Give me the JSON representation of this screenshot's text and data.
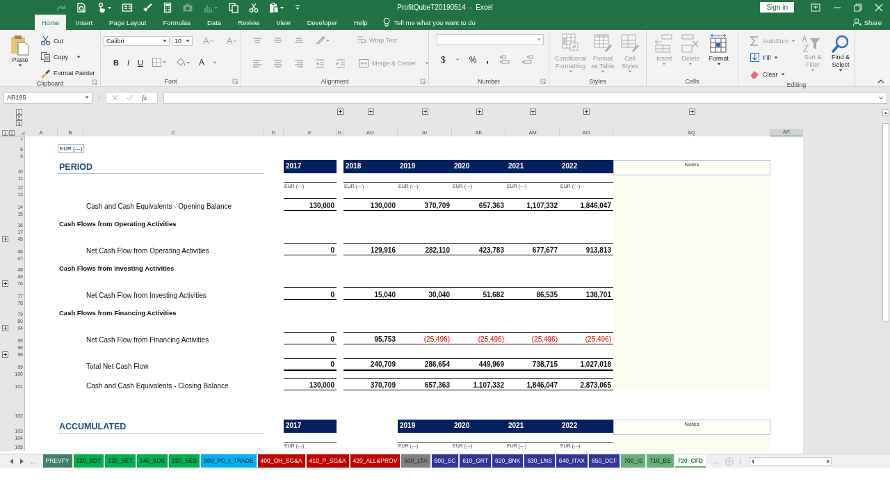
{
  "title_bar": {
    "title": "ProfitQubeT20190514  -  Excel",
    "sign_in": "Sign in",
    "quick_access": [
      {
        "disabled": true
      },
      {
        "disabled": false
      },
      {
        "disabled": false
      },
      {
        "disabled": false
      },
      {
        "disabled": false
      },
      {
        "disabled": false
      },
      {
        "disabled": true
      },
      {
        "disabled": true
      },
      {
        "disabled": false
      },
      {
        "disabled": false
      },
      {
        "disabled": false
      },
      {
        "disabled": false
      }
    ]
  },
  "ribbon_tabs": {
    "tabs": [
      {
        "label": "Home",
        "selected": true
      },
      {
        "label": "Insert",
        "selected": false
      },
      {
        "label": "Page Layout",
        "selected": false
      },
      {
        "label": "Formulas",
        "selected": false
      },
      {
        "label": "Data",
        "selected": false
      },
      {
        "label": "Review",
        "selected": false
      },
      {
        "label": "View",
        "selected": false
      },
      {
        "label": "Developer",
        "selected": false
      },
      {
        "label": "Help",
        "selected": false
      }
    ],
    "tell_me": "Tell me what you want to do",
    "share": "Share"
  },
  "ribbon": {
    "groups": [
      {
        "kind": "clipboard",
        "label": "Clipboard",
        "paste": "Paste",
        "items": [
          "Cut",
          "Copy",
          "Format Painter"
        ]
      },
      {
        "kind": "font",
        "label": "Font",
        "disabled": true,
        "font_name": "Calibri",
        "font_size": "10",
        "grow": "A",
        "shrink": "A",
        "bold": "B",
        "italic": "I",
        "underline": "U",
        "font_color": "A"
      },
      {
        "kind": "alignment",
        "label": "Alignment",
        "disabled": true,
        "wrap_text": "Wrap Text",
        "merge": "Merge & Center"
      },
      {
        "kind": "number",
        "label": "Number",
        "disabled": true,
        "currency": "$",
        "percent": "%",
        "comma": ","
      },
      {
        "kind": "styles",
        "label": "Styles",
        "items": [
          {
            "label": "Conditional Formatting",
            "disabled": true
          },
          {
            "label": "Format as Table",
            "disabled": true
          },
          {
            "label": "Cell Styles",
            "disabled": true
          }
        ]
      },
      {
        "kind": "cells",
        "label": "Cells",
        "items": [
          {
            "label": "Insert",
            "disabled": true
          },
          {
            "label": "Delete",
            "disabled": true
          },
          {
            "label": "Format",
            "disabled": false
          }
        ]
      },
      {
        "kind": "editing",
        "label": "Editing",
        "items": [
          {
            "kind": "small",
            "label": "AutoSum",
            "disabled": true
          },
          {
            "kind": "small",
            "label": "Fill",
            "disabled": false
          },
          {
            "kind": "small",
            "label": "Clear",
            "disabled": false
          },
          {
            "kind": "large",
            "label": "Sort & Filter",
            "disabled": true
          },
          {
            "kind": "large",
            "label": "Find & Select",
            "disabled": false
          }
        ]
      }
    ]
  },
  "formula_bar": {
    "name_box": "AR195",
    "function_button": "fx"
  },
  "sheet": {
    "column_outline_levels": [
      "1",
      "2",
      "3"
    ],
    "row_outline_levels": [
      "1",
      "2"
    ],
    "columns": [
      {
        "label": "A",
        "selected": false,
        "collapsed_group": false
      },
      {
        "label": "B",
        "selected": false,
        "collapsed_group": false
      },
      {
        "label": "C",
        "selected": false,
        "collapsed_group": false
      },
      {
        "label": "D",
        "selected": false,
        "collapsed_group": false
      },
      {
        "label": "E",
        "selected": false,
        "collapsed_group": false
      },
      {
        "label": "G",
        "selected": false,
        "collapsed_group": true
      },
      {
        "label": "AG",
        "selected": false,
        "collapsed_group": true
      },
      {
        "label": "AI",
        "selected": false,
        "collapsed_group": true
      },
      {
        "label": "AK",
        "selected": false,
        "collapsed_group": true
      },
      {
        "label": "AM",
        "selected": false,
        "collapsed_group": true
      },
      {
        "label": "AO",
        "selected": false,
        "collapsed_group": true
      },
      {
        "label": "AQ",
        "selected": false,
        "collapsed_group": true
      },
      {
        "label": "AR",
        "selected": true,
        "collapsed_group": false
      }
    ],
    "rows": [
      {
        "number": "7",
        "kind": "gap",
        "collapsed": false
      },
      {
        "number": "8",
        "kind": "unit",
        "collapsed": false,
        "text": "EUR (---)"
      },
      {
        "number": "9",
        "kind": "gap",
        "collapsed": false
      },
      {
        "number": "10",
        "kind": "title",
        "collapsed": false,
        "title": "PERIOD",
        "notes": "Notes",
        "years": [
          {
            "kind": "year",
            "text": "2017"
          },
          {
            "kind": "year",
            "text": "2018"
          },
          {
            "kind": "year",
            "text": "2019"
          },
          {
            "kind": "year",
            "text": "2020"
          },
          {
            "kind": "year",
            "text": "2021"
          },
          {
            "kind": "year",
            "text": "2022"
          }
        ]
      },
      {
        "number": "11",
        "kind": "gap",
        "collapsed": false
      },
      {
        "number": "12",
        "kind": "units",
        "collapsed": false,
        "units": [
          {
            "kind": "unit",
            "text": "EUR (---)"
          },
          {
            "kind": "unit",
            "text": "EUR (---)"
          },
          {
            "kind": "unit",
            "text": "EUR (---)"
          },
          {
            "kind": "unit",
            "text": "EUR (---)"
          },
          {
            "kind": "unit",
            "text": "EUR (---)"
          },
          {
            "kind": "unit",
            "text": "EUR (---)"
          }
        ]
      },
      {
        "number": "13",
        "kind": "gap",
        "collapsed": false
      },
      {
        "number": "14",
        "kind": "value",
        "collapsed": false,
        "label": "Cash and Cash Equivalents - Opening Balance",
        "values": [
          {
            "text": "130,000",
            "negative": false
          },
          {
            "text": "130,000",
            "negative": false
          },
          {
            "text": "370,709",
            "negative": false
          },
          {
            "text": "657,363",
            "negative": false
          },
          {
            "text": "1,107,332",
            "negative": false
          },
          {
            "text": "1,846,047",
            "negative": false
          }
        ]
      },
      {
        "number": "15",
        "kind": "gap",
        "collapsed": false
      },
      {
        "number": "16",
        "kind": "section",
        "collapsed": false,
        "label": "Cash Flows from Operating Activities"
      },
      {
        "number": "17",
        "kind": "gap",
        "collapsed": false
      },
      {
        "number": "45",
        "kind": "gap",
        "collapsed": true
      },
      {
        "number": "46",
        "kind": "value",
        "collapsed": false,
        "label": "Net Cash Flow from Operating Activities",
        "values": [
          {
            "text": "0",
            "negative": false
          },
          {
            "text": "129,916",
            "negative": false
          },
          {
            "text": "282,110",
            "negative": false
          },
          {
            "text": "423,783",
            "negative": false
          },
          {
            "text": "677,677",
            "negative": false
          },
          {
            "text": "913,813",
            "negative": false
          }
        ]
      },
      {
        "number": "47",
        "kind": "gap",
        "collapsed": false
      },
      {
        "number": "48",
        "kind": "section",
        "collapsed": false,
        "label": "Cash Flows from Investing Activities"
      },
      {
        "number": "49",
        "kind": "gap",
        "collapsed": false
      },
      {
        "number": "76",
        "kind": "gap",
        "collapsed": true
      },
      {
        "number": "77",
        "kind": "value",
        "collapsed": false,
        "label": "Net Cash Flow from Investing Activities",
        "values": [
          {
            "text": "0",
            "negative": false
          },
          {
            "text": "15,040",
            "negative": false
          },
          {
            "text": "30,040",
            "negative": false
          },
          {
            "text": "51,682",
            "negative": false
          },
          {
            "text": "86,535",
            "negative": false
          },
          {
            "text": "138,701",
            "negative": false
          }
        ]
      },
      {
        "number": "78",
        "kind": "gap",
        "collapsed": false
      },
      {
        "number": "79",
        "kind": "section",
        "collapsed": false,
        "label": "Cash Flows from Financing Activities"
      },
      {
        "number": "80",
        "kind": "gap",
        "collapsed": false
      },
      {
        "number": "94",
        "kind": "gap",
        "collapsed": true
      },
      {
        "number": "95",
        "kind": "value",
        "collapsed": false,
        "label": "Net Cash Flow from Financing Activities",
        "values": [
          {
            "text": "0",
            "negative": false
          },
          {
            "text": "95,753",
            "negative": false
          },
          {
            "text": "(25,496)",
            "negative": true
          },
          {
            "text": "(25,496)",
            "negative": true
          },
          {
            "text": "(25,496)",
            "negative": true
          },
          {
            "text": "(25,496)",
            "negative": true
          }
        ]
      },
      {
        "number": "96",
        "kind": "gap",
        "collapsed": false
      },
      {
        "number": "98",
        "kind": "gap",
        "collapsed": true
      },
      {
        "number": "99",
        "kind": "total",
        "collapsed": false,
        "label": "Total Net Cash Flow",
        "values": [
          {
            "text": "0",
            "negative": false
          },
          {
            "text": "240,709",
            "negative": false
          },
          {
            "text": "286,654",
            "negative": false
          },
          {
            "text": "449,969",
            "negative": false
          },
          {
            "text": "738,715",
            "negative": false
          },
          {
            "text": "1,027,018",
            "negative": false
          }
        ]
      },
      {
        "number": "100",
        "kind": "gap",
        "collapsed": false
      },
      {
        "number": "101",
        "kind": "value",
        "collapsed": false,
        "label": "Cash and Cash Equivalents - Closing Balance",
        "values": [
          {
            "text": "130,000",
            "negative": false
          },
          {
            "text": "370,709",
            "negative": false
          },
          {
            "text": "657,363",
            "negative": false
          },
          {
            "text": "1,107,332",
            "negative": false
          },
          {
            "text": "1,846,047",
            "negative": false
          },
          {
            "text": "2,873,065",
            "negative": false
          }
        ]
      },
      {
        "number": "102",
        "kind": "break",
        "collapsed": false
      },
      {
        "number": "103",
        "kind": "title",
        "collapsed": false,
        "title": "ACCUMULATED",
        "notes": "Notes",
        "years": [
          {
            "kind": "year",
            "text": "2017"
          },
          {
            "kind": "empty"
          },
          {
            "kind": "year",
            "text": "2019"
          },
          {
            "kind": "year",
            "text": "2020"
          },
          {
            "kind": "year",
            "text": "2021"
          },
          {
            "kind": "year",
            "text": "2022"
          }
        ]
      },
      {
        "number": "104",
        "kind": "gap",
        "collapsed": false
      },
      {
        "number": "105",
        "kind": "units",
        "collapsed": false,
        "units": [
          {
            "kind": "unit",
            "text": "EUR (---)"
          },
          {
            "kind": "empty"
          },
          {
            "kind": "unit",
            "text": "EUR (---)"
          },
          {
            "kind": "unit",
            "text": "EUR (---)"
          },
          {
            "kind": "unit",
            "text": "EUR (---)"
          },
          {
            "kind": "unit",
            "text": "EUR (---)"
          }
        ]
      }
    ]
  },
  "sheet_tabs": {
    "more_left": "...",
    "more_right": "...",
    "tabs": [
      {
        "label": "PREVFY",
        "color": "#3f7f6a",
        "selected": false
      },
      {
        "label": "120_SDT",
        "color": "#00b050",
        "selected": false
      },
      {
        "label": "130_SET",
        "color": "#00b050",
        "selected": false
      },
      {
        "label": "140_SDS",
        "color": "#00b050",
        "selected": false
      },
      {
        "label": "150_SES",
        "color": "#00b050",
        "selected": false
      },
      {
        "label": "300_PC_I_TRADE",
        "color": "#00b0f0",
        "selected": false
      },
      {
        "label": "400_OH_SG&A",
        "color": "#c00000",
        "selected": false
      },
      {
        "label": "410_P_SG&A",
        "color": "#c00000",
        "selected": false
      },
      {
        "label": "420_ALL&PROV",
        "color": "#c00000",
        "selected": false
      },
      {
        "label": "500_LTA",
        "color": "#808080",
        "selected": false
      },
      {
        "label": "600_SC",
        "color": "#333399",
        "selected": false
      },
      {
        "label": "610_GRT",
        "color": "#333399",
        "selected": false
      },
      {
        "label": "620_BNK",
        "color": "#333399",
        "selected": false
      },
      {
        "label": "630_LNS",
        "color": "#333399",
        "selected": false
      },
      {
        "label": "640_ITAX",
        "color": "#333399",
        "selected": false
      },
      {
        "label": "650_DCF",
        "color": "#333399",
        "selected": false
      },
      {
        "label": "700_IS",
        "color": "#66b27a",
        "selected": false
      },
      {
        "label": "710_BS",
        "color": "#66b27a",
        "selected": false
      },
      {
        "label": "720_CFD",
        "color": "#66b27a",
        "selected": true
      }
    ]
  }
}
